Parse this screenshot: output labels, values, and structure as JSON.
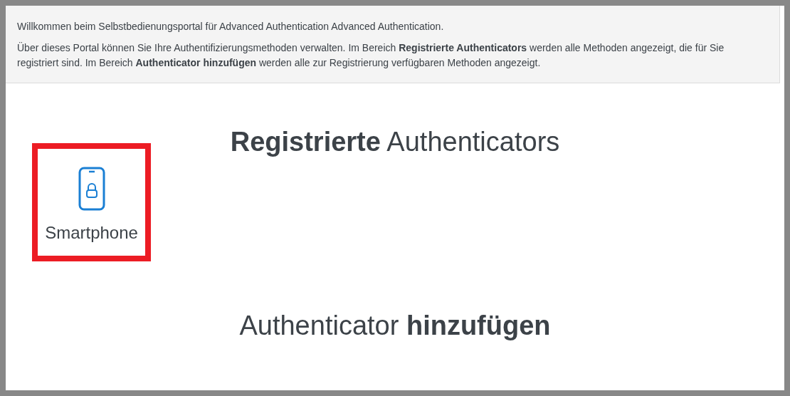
{
  "info_panel": {
    "paragraphs": [
      "Willkommen beim Selbstbedienungsportal für Advanced Authentication Advanced Authentication.",
      "Über dieses Portal können Sie Ihre Authentifizierungsmethoden verwalten. Im Bereich **Registrierte Authenticators** werden alle Methoden angezeigt, die für Sie registriert sind. Im Bereich **Authenticator hinzufügen** werden alle zur Registrierung verfügbaren Methoden angezeigt."
    ]
  },
  "registered_section": {
    "heading": "**Registrierte** Authenticators",
    "authenticators": [
      {
        "label": "Smartphone",
        "highlighted": true
      }
    ]
  },
  "add_section": {
    "heading": "Authenticator **hinzufügen**"
  }
}
